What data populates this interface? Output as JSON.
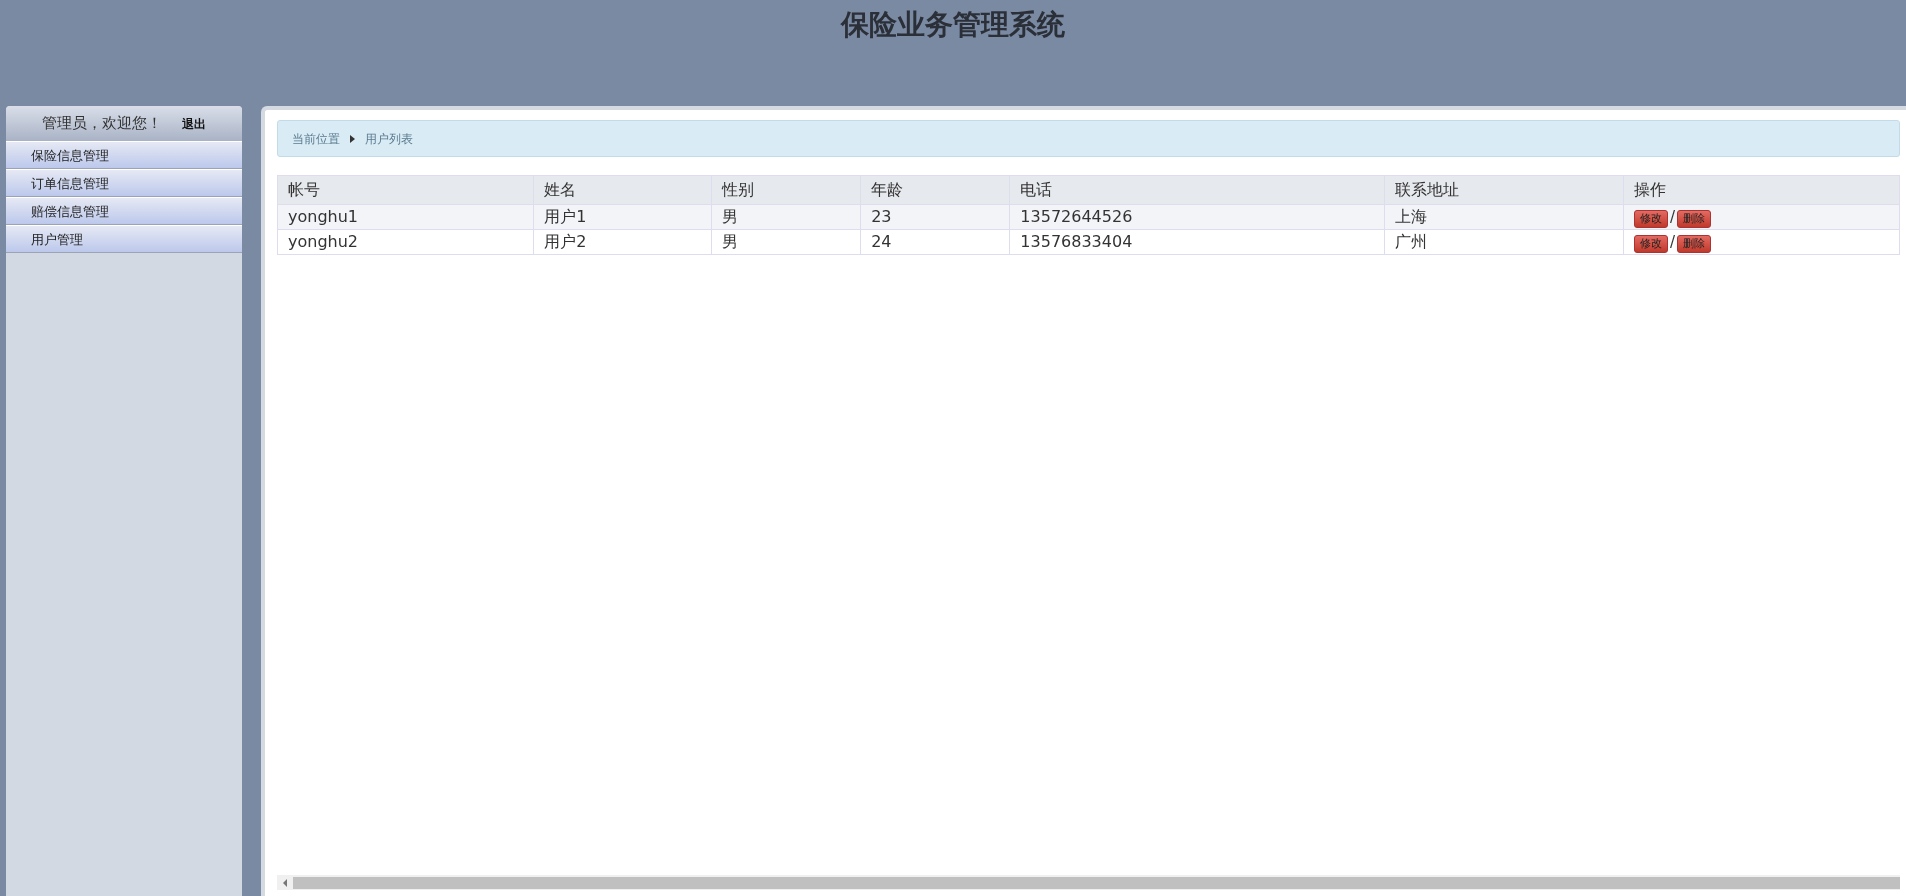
{
  "header": {
    "title": "保险业务管理系统"
  },
  "sidebar": {
    "welcome": "管理员，欢迎您！",
    "logout": "退出",
    "items": [
      {
        "label": "保险信息管理"
      },
      {
        "label": "订单信息管理"
      },
      {
        "label": "赔偿信息管理"
      },
      {
        "label": "用户管理"
      }
    ]
  },
  "breadcrumb": {
    "label": "当前位置",
    "current": "用户列表"
  },
  "table": {
    "columns": [
      "帐号",
      "姓名",
      "性别",
      "年龄",
      "电话",
      "联系地址",
      "操作"
    ],
    "rows": [
      {
        "cells": [
          "yonghu1",
          "用户1",
          "男",
          "23",
          "13572644526",
          "上海"
        ],
        "actions": [
          "修改",
          "/",
          "删除"
        ]
      },
      {
        "cells": [
          "yonghu2",
          "用户2",
          "男",
          "24",
          "13576833404",
          "广州"
        ],
        "actions": [
          "修改",
          "/",
          "删除"
        ]
      }
    ]
  }
}
